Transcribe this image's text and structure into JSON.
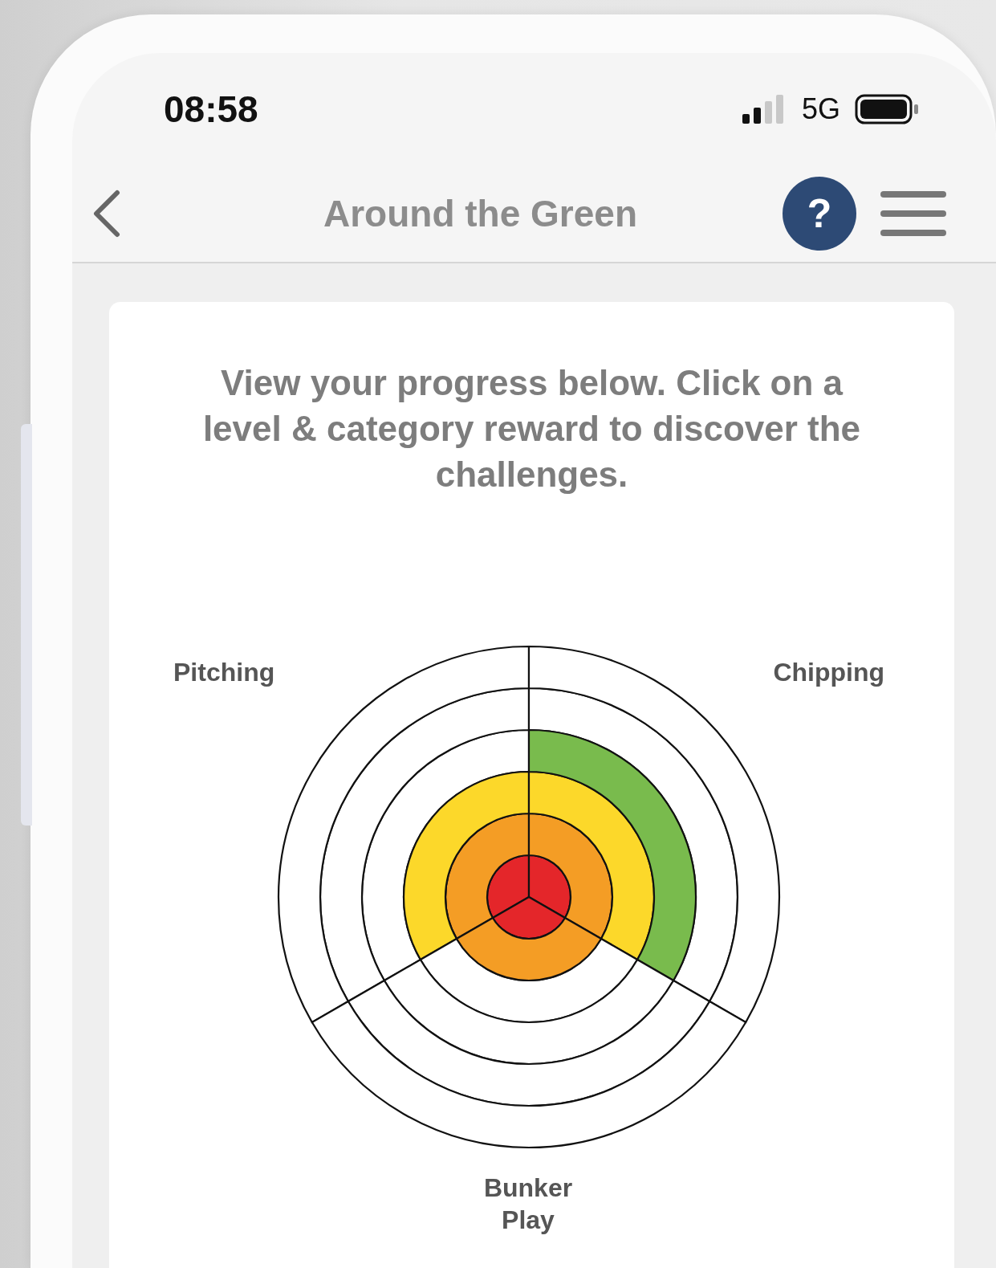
{
  "status_bar": {
    "time": "08:58",
    "network": "5G"
  },
  "nav": {
    "title": "Around the Green",
    "help_label": "?"
  },
  "card": {
    "instructions": "View your progress below. Click on a level & category reward to discover the challenges.",
    "wheel": {
      "categories": [
        {
          "label": "Pitching"
        },
        {
          "label": "Chipping"
        },
        {
          "label": "Bunker Play"
        }
      ]
    }
  }
}
